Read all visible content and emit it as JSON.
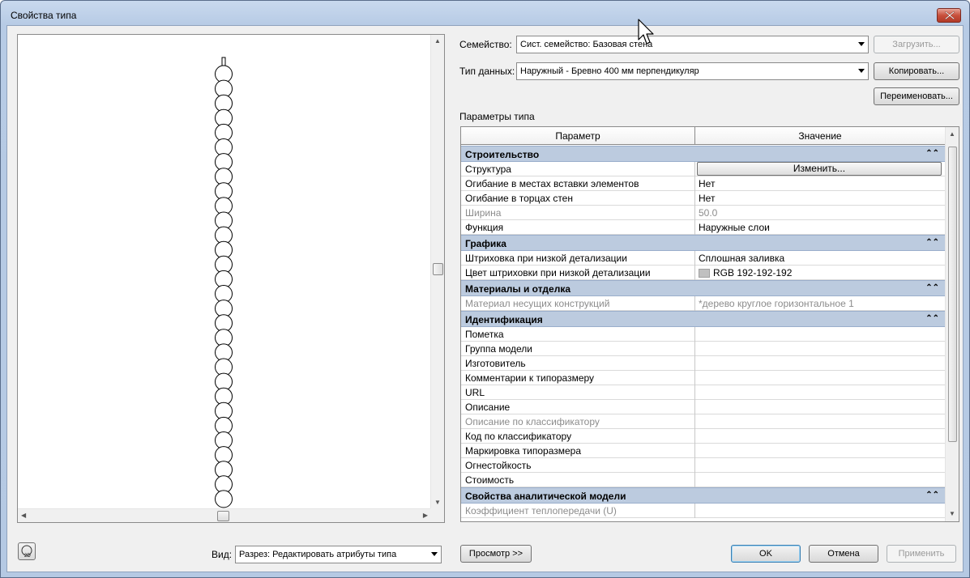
{
  "window": {
    "title": "Свойства типа"
  },
  "family": {
    "label": "Семейство:",
    "value": "Сист. семейство: Базовая стена",
    "load_button": "Загрузить..."
  },
  "type": {
    "label": "Тип данных:",
    "value": "Наружный - Бревно 400 мм перпендикуляр",
    "duplicate_button": "Копировать...",
    "rename_button": "Переименовать..."
  },
  "type_parameters_label": "Параметры типа",
  "table": {
    "headers": [
      "Параметр",
      "Значение"
    ],
    "groups": [
      {
        "name": "Строительство",
        "rows": [
          {
            "p": "Структура",
            "v": "Изменить...",
            "kind": "button"
          },
          {
            "p": "Огибание в местах вставки элементов",
            "v": "Нет"
          },
          {
            "p": "Огибание в торцах стен",
            "v": "Нет"
          },
          {
            "p": "Ширина",
            "v": "50.0",
            "gray": true
          },
          {
            "p": "Функция",
            "v": "Наружные слои"
          }
        ]
      },
      {
        "name": "Графика",
        "rows": [
          {
            "p": "Штриховка при низкой детализации",
            "v": "Сплошная заливка"
          },
          {
            "p": "Цвет штриховки при низкой детализации",
            "v": "RGB 192-192-192",
            "kind": "color"
          }
        ]
      },
      {
        "name": "Материалы и отделка",
        "rows": [
          {
            "p": "Материал несущих конструкций",
            "v": "*дерево круглое горизонтальное 1",
            "gray": true
          }
        ]
      },
      {
        "name": "Идентификация",
        "rows": [
          {
            "p": "Пометка",
            "v": ""
          },
          {
            "p": "Группа модели",
            "v": ""
          },
          {
            "p": "Изготовитель",
            "v": ""
          },
          {
            "p": "Комментарии к типоразмеру",
            "v": ""
          },
          {
            "p": "URL",
            "v": ""
          },
          {
            "p": "Описание",
            "v": ""
          },
          {
            "p": "Описание по классификатору",
            "v": "",
            "gray": true
          },
          {
            "p": "Код по классификатору",
            "v": ""
          },
          {
            "p": "Маркировка типоразмера",
            "v": ""
          },
          {
            "p": "Огнестойкость",
            "v": ""
          },
          {
            "p": "Стоимость",
            "v": ""
          }
        ]
      },
      {
        "name": "Свойства аналитической модели",
        "rows": [
          {
            "p": "Коэффициент теплопередачи (U)",
            "v": "",
            "gray": true
          }
        ]
      }
    ]
  },
  "bottom": {
    "view_label": "Вид:",
    "view_value": "Разрез: Редактировать атрибуты типа",
    "preview_button": "Просмотр >>",
    "ok_button": "OK",
    "cancel_button": "Отмена",
    "apply_button": "Применить"
  },
  "preview": {
    "log_count": 30
  },
  "icons": {
    "close": "close-icon",
    "view2d": "2d-view-icon",
    "collapse": "collapse-chevron-icon",
    "cursor": "mouse-cursor-icon"
  },
  "colors": {
    "group_header": "#bccbdf",
    "titlebar": "#c9d9ee",
    "close": "#c8503c",
    "swatch": "#c0c0c0"
  }
}
